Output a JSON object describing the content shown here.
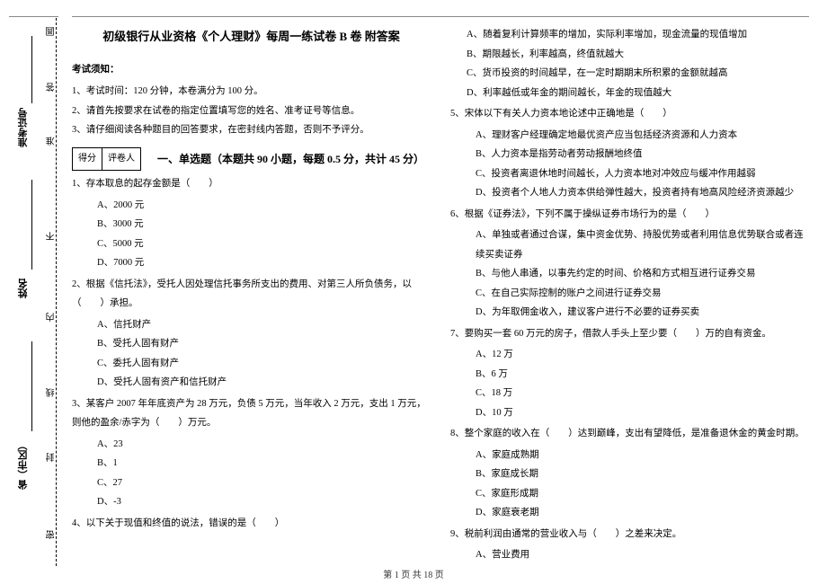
{
  "gutter": {
    "markers": [
      "圆",
      "答",
      "准",
      "不",
      "内",
      "线",
      "封",
      "密"
    ],
    "fields": {
      "ticket": "准考证号",
      "name": "姓名",
      "region": "省（市区）"
    }
  },
  "title": "初级银行从业资格《个人理财》每周一练试卷 B 卷  附答案",
  "notice_head": "考试须知：",
  "notices": [
    "1、考试时间：120 分钟，本卷满分为 100 分。",
    "2、请首先按要求在试卷的指定位置填写您的姓名、准考证号等信息。",
    "3、请仔细阅读各种题目的回答要求，在密封线内答题，否则不予评分。"
  ],
  "score_labels": {
    "score": "得分",
    "grader": "评卷人"
  },
  "section1": "一、单选题（本题共 90 小题，每题 0.5 分，共计 45 分）",
  "left_questions": [
    {
      "stem": "1、存本取息的起存金额是（　　）",
      "opts": [
        "A、2000 元",
        "B、3000 元",
        "C、5000 元",
        "D、7000 元"
      ]
    },
    {
      "stem": "2、根据《信托法》，受托人因处理信托事务所支出的费用、对第三人所负债务，以（　　）承担。",
      "opts": [
        "A、信托财产",
        "B、受托人固有财产",
        "C、委托人固有财产",
        "D、受托人固有资产和信托财产"
      ]
    },
    {
      "stem": "3、某客户 2007 年年底资产为 28 万元，负债 5 万元，当年收入 2 万元，支出 1 万元，则他的盈余/赤字为（　　）万元。",
      "opts": [
        "A、23",
        "B、1",
        "C、27",
        "D、-3"
      ]
    },
    {
      "stem_only": "4、以下关于现值和终值的说法，错误的是（　　）"
    }
  ],
  "right_top_opts": [
    "A、随着复利计算频率的增加，实际利率增加，现金流量的现值增加",
    "B、期限越长，利率越高，终值就越大",
    "C、货币投资的时间越早，在一定时期期末所积累的金额就越高",
    "D、利率越低或年金的期间越长，年金的现值越大"
  ],
  "right_questions": [
    {
      "stem": "5、宋体以下有关人力资本地论述中正确地是（　　）",
      "opts": [
        "A、理财客户经理确定地最优资产应当包括经济资源和人力资本",
        "B、人力资本是指劳动者劳动报酬地终值",
        "C、投资者离退休地时间越长，人力资本地对冲效应与缓冲作用越弱",
        "D、投资者个人地人力资本供给弹性越大，投资者持有地高风险经济资源越少"
      ]
    },
    {
      "stem": "6、根据《证券法》，下列不属于操纵证券市场行为的是（　　）",
      "opts": [
        "A、单独或者通过合谋，集中资金优势、持股优势或者利用信息优势联合或者连续买卖证券",
        "B、与他人串通，以事先约定的时间、价格和方式相互进行证券交易",
        "C、在自己实际控制的账户之间进行证券交易",
        "D、为年取佣金收入，建议客户进行不必要的证券买卖"
      ]
    },
    {
      "stem": "7、要购买一套 60 万元的房子，借款人手头上至少要（　　）万的自有资金。",
      "opts": [
        "A、12 万",
        "B、6 万",
        "C、18 万",
        "D、10 万"
      ]
    },
    {
      "stem": "8、整个家庭的收入在（　　）达到巅峰，支出有望降低，是准备退休金的黄金时期。",
      "opts": [
        "A、家庭成熟期",
        "B、家庭成长期",
        "C、家庭形成期",
        "D、家庭衰老期"
      ]
    },
    {
      "stem": "9、税前利润由通常的营业收入与（　　）之差来决定。",
      "opts_partial": [
        "A、营业费用"
      ]
    }
  ],
  "footer": "第 1 页  共 18 页"
}
